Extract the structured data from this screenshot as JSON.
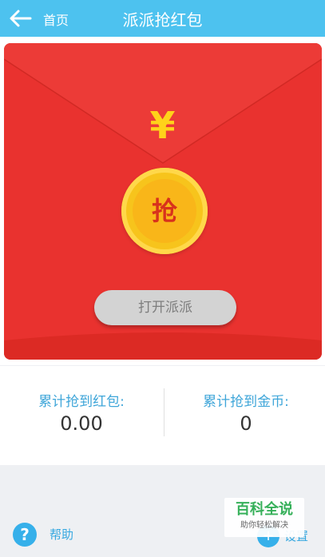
{
  "header": {
    "back_label": "首页",
    "title": "派派抢红包"
  },
  "envelope": {
    "yen_symbol": "¥",
    "coin_label": "抢",
    "open_button_label": "打开派派"
  },
  "stats": {
    "red_packets_label": "累计抢到红包:",
    "red_packets_value": "0.00",
    "coins_label": "累计抢到金币:",
    "coins_value": "0"
  },
  "footer": {
    "help_label": "帮助",
    "settings_label": "设置"
  },
  "watermark": {
    "title": "百科全说",
    "subtitle": "助你轻松解决"
  },
  "colors": {
    "header": "#4dc2ef",
    "envelope_red": "#e9322f",
    "coin_gold": "#f7c41c",
    "accent_blue": "#36b0ea"
  }
}
